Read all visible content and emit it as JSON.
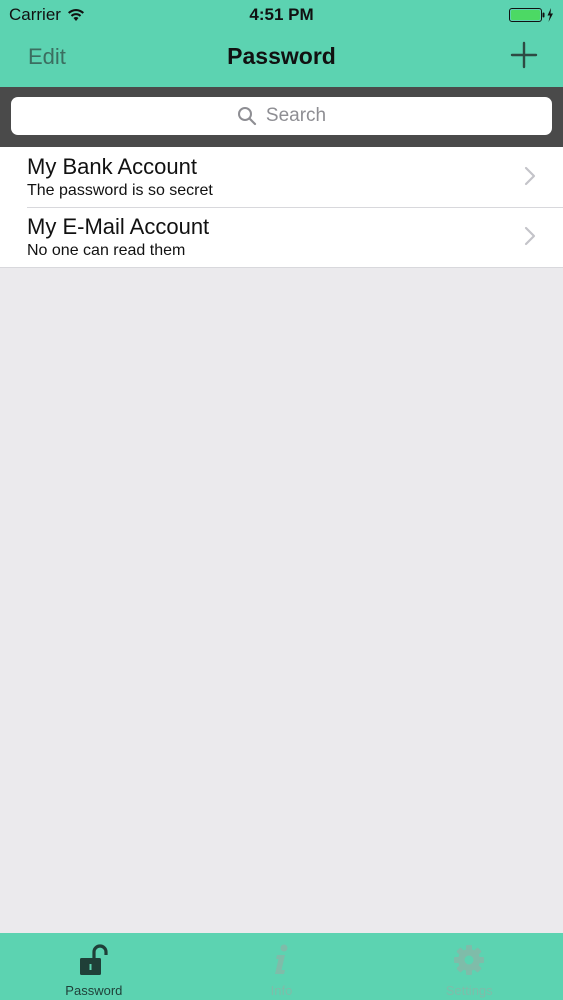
{
  "status_bar": {
    "carrier": "Carrier",
    "time": "4:51 PM",
    "wifi_icon": "wifi-icon",
    "battery_icon": "battery-charging-icon"
  },
  "nav": {
    "edit_label": "Edit",
    "title": "Password",
    "add_icon": "plus-icon"
  },
  "search": {
    "placeholder": "Search",
    "icon": "search-icon"
  },
  "accounts": [
    {
      "title": "My Bank Account",
      "subtitle": "The password is so secret"
    },
    {
      "title": "My E-Mail Account",
      "subtitle": "No one can read them"
    }
  ],
  "tab_bar": {
    "tabs": [
      {
        "label": "Password",
        "icon": "unlocked-padlock-icon",
        "active": true
      },
      {
        "label": "Info",
        "icon": "info-icon",
        "active": false
      },
      {
        "label": "Settings",
        "icon": "gear-icon",
        "active": false
      }
    ]
  },
  "colors": {
    "accent": "#5cd3b1",
    "search_bar_bg": "#4a4a4a",
    "background": "#ebeaed"
  }
}
